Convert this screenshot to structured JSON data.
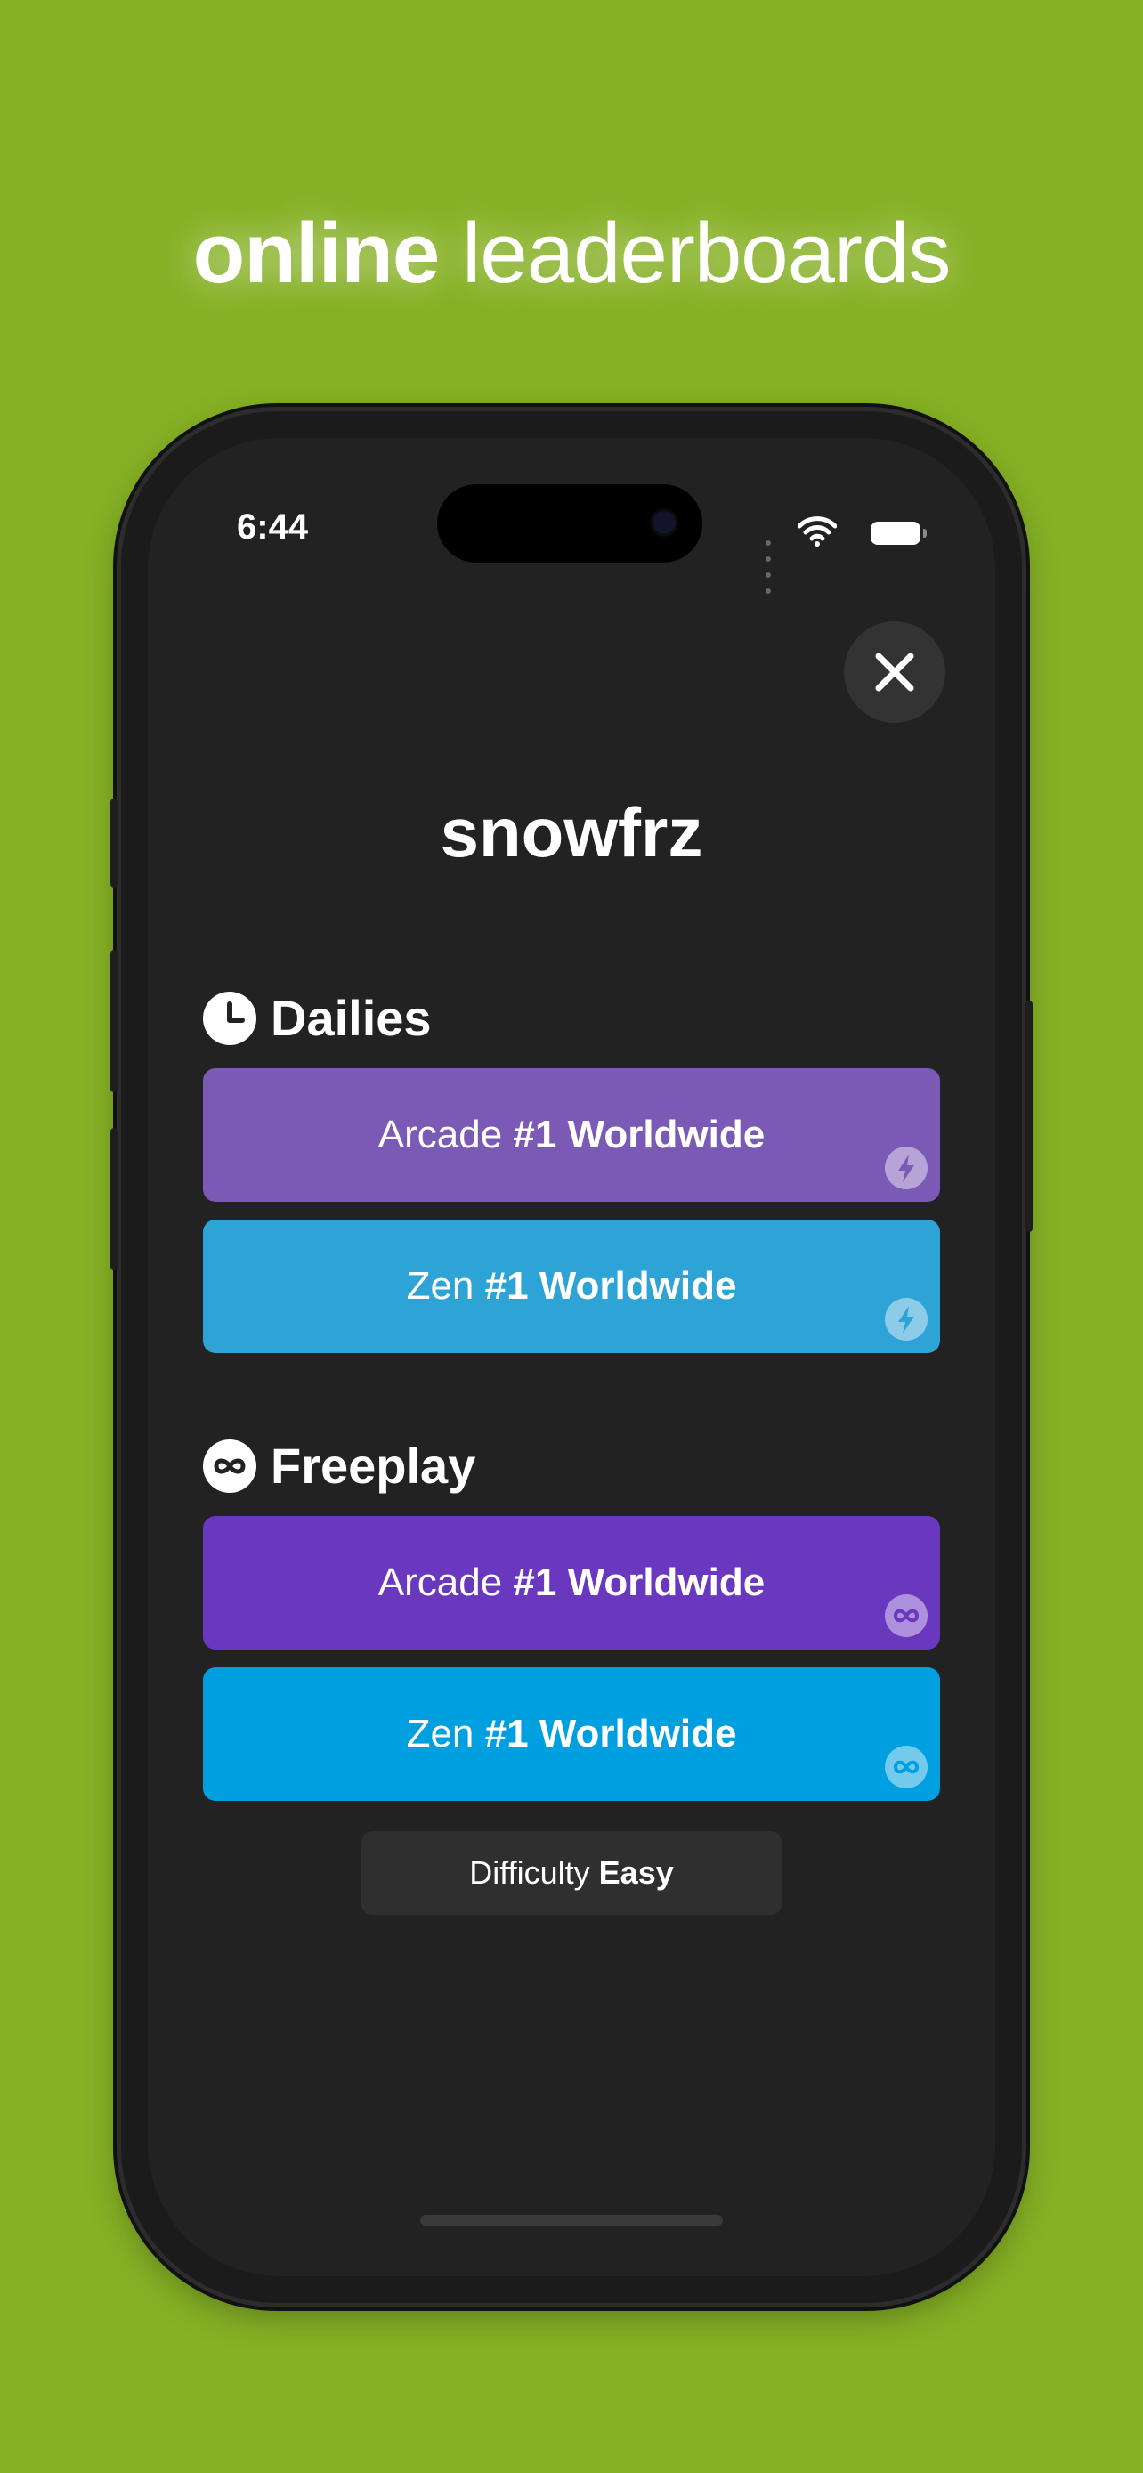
{
  "headline": {
    "bold": "online",
    "light": "leaderboards"
  },
  "status_bar": {
    "time": "6:44"
  },
  "player": {
    "name": "snowfrz"
  },
  "sections": [
    {
      "title": "Dailies",
      "icon": "clock-icon",
      "cards": [
        {
          "mode": "Arcade",
          "rank": "#1 Worldwide",
          "color": "#7b5ab6",
          "badge": "bolt-icon"
        },
        {
          "mode": "Zen",
          "rank": "#1 Worldwide",
          "color": "#2ea3d5",
          "badge": "bolt-icon"
        }
      ]
    },
    {
      "title": "Freeplay",
      "icon": "infinity-icon",
      "cards": [
        {
          "mode": "Arcade",
          "rank": "#1 Worldwide",
          "color": "#6a37bf",
          "badge": "infinity-icon"
        },
        {
          "mode": "Zen",
          "rank": "#1 Worldwide",
          "color": "#009fdf",
          "badge": "infinity-icon"
        }
      ]
    }
  ],
  "difficulty": {
    "label": "Difficulty",
    "value": "Easy"
  },
  "colors": {
    "background": "#86b125",
    "screen": "#222222",
    "button": "#333333"
  }
}
